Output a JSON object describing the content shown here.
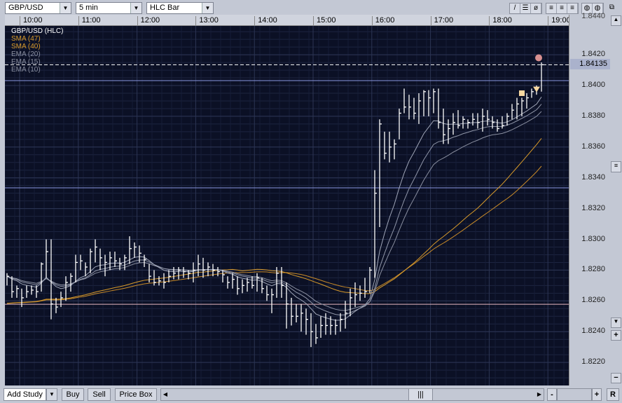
{
  "toolbar": {
    "symbol": "GBP/USD",
    "interval": "5 min",
    "chart_type": "HLC Bar",
    "tools": [
      "line-tool-icon",
      "hline-tool-icon",
      "no-draw-icon",
      "grid1-icon",
      "grid2-icon",
      "grid3-icon",
      "theme1-icon",
      "theme2-icon",
      "window-icon"
    ]
  },
  "time_axis": [
    "10:00",
    "11:00",
    "12:00",
    "13:00",
    "14:00",
    "15:00",
    "16:00",
    "17:00",
    "18:00",
    "19:00"
  ],
  "price_axis": [
    "1.8420",
    "1.8400",
    "1.8380",
    "1.8360",
    "1.8340",
    "1.8320",
    "1.8300",
    "1.8280",
    "1.8260",
    "1.8240",
    "1.8220"
  ],
  "price_axis_top_partial": "1.8440",
  "current_price": "1.84135",
  "legend": [
    {
      "label": "GBP/USD (HLC)",
      "color": "#ffffff"
    },
    {
      "label": "SMA (47)",
      "color": "#d89a2a"
    },
    {
      "label": "SMA (40)",
      "color": "#d89a2a"
    },
    {
      "label": "EMA (20)",
      "color": "#8a8fa0"
    },
    {
      "label": "EMA (15)",
      "color": "#8a8fa0"
    },
    {
      "label": "EMA (10)",
      "color": "#8a8fa0"
    }
  ],
  "bottom": {
    "add_study": "Add Study",
    "buy": "Buy",
    "sell": "Sell",
    "price_box": "Price Box",
    "zoom_out": "-",
    "zoom_in": "+",
    "reset": "R"
  },
  "chart_data": {
    "type": "hlc-bar",
    "start_time": "09:45",
    "interval_minutes": 5,
    "ylim": [
      1.8208,
      1.8442
    ],
    "horizontal_lines": [
      {
        "price": 1.84135,
        "style": "dashed",
        "color": "#ffffff"
      },
      {
        "price": 1.84032,
        "color": "#8a96e0"
      },
      {
        "price": 1.83335,
        "color": "#8a96e0"
      },
      {
        "price": 1.82578,
        "color": "#e8b8c0"
      }
    ],
    "markers": [
      {
        "type": "square",
        "bar": 105,
        "price": 1.8395,
        "color": "#f8d8a0"
      },
      {
        "type": "triangle-down",
        "bar": 108,
        "price": 1.8397,
        "color": "#f8d8a0"
      },
      {
        "type": "circle",
        "bar": 109,
        "price": 1.8418,
        "color": "#d89090"
      }
    ],
    "bars": [
      [
        1.8278,
        1.827,
        1.8276
      ],
      [
        1.8276,
        1.8262,
        1.8266
      ],
      [
        1.827,
        1.8262,
        1.8268
      ],
      [
        1.8268,
        1.8256,
        1.8262
      ],
      [
        1.827,
        1.8262,
        1.8266
      ],
      [
        1.827,
        1.8264,
        1.8267
      ],
      [
        1.827,
        1.8262,
        1.8266
      ],
      [
        1.8285,
        1.8266,
        1.8284
      ],
      [
        1.83,
        1.8275,
        1.8292
      ],
      [
        1.83,
        1.8248,
        1.8258
      ],
      [
        1.8262,
        1.8252,
        1.8256
      ],
      [
        1.8266,
        1.8256,
        1.8262
      ],
      [
        1.8276,
        1.826,
        1.8272
      ],
      [
        1.8278,
        1.8266,
        1.8276
      ],
      [
        1.829,
        1.8272,
        1.8285
      ],
      [
        1.829,
        1.828,
        1.8286
      ],
      [
        1.8285,
        1.8276,
        1.8282
      ],
      [
        1.8294,
        1.8278,
        1.8292
      ],
      [
        1.83,
        1.8285,
        1.8295
      ],
      [
        1.8294,
        1.828,
        1.8288
      ],
      [
        1.829,
        1.8276,
        1.8285
      ],
      [
        1.8292,
        1.828,
        1.8288
      ],
      [
        1.8292,
        1.8282,
        1.8286
      ],
      [
        1.8288,
        1.828,
        1.8284
      ],
      [
        1.829,
        1.828,
        1.8288
      ],
      [
        1.8302,
        1.8284,
        1.8294
      ],
      [
        1.8298,
        1.8288,
        1.8295
      ],
      [
        1.8296,
        1.8285,
        1.8291
      ],
      [
        1.829,
        1.8282,
        1.8287
      ],
      [
        1.8284,
        1.8272,
        1.8276
      ],
      [
        1.828,
        1.827,
        1.8272
      ],
      [
        1.8276,
        1.827,
        1.8273
      ],
      [
        1.8278,
        1.8268,
        1.8272
      ],
      [
        1.828,
        1.8272,
        1.8276
      ],
      [
        1.8282,
        1.8274,
        1.8278
      ],
      [
        1.8282,
        1.8274,
        1.828
      ],
      [
        1.8282,
        1.8275,
        1.8279
      ],
      [
        1.828,
        1.8274,
        1.8278
      ],
      [
        1.8285,
        1.8272,
        1.828
      ],
      [
        1.829,
        1.8276,
        1.8284
      ],
      [
        1.8288,
        1.8275,
        1.828
      ],
      [
        1.8285,
        1.8276,
        1.8282
      ],
      [
        1.8284,
        1.8276,
        1.828
      ],
      [
        1.8282,
        1.8276,
        1.8279
      ],
      [
        1.828,
        1.8272,
        1.8277
      ],
      [
        1.8276,
        1.8268,
        1.8272
      ],
      [
        1.8278,
        1.8268,
        1.8274
      ],
      [
        1.8276,
        1.8264,
        1.8268
      ],
      [
        1.8274,
        1.8265,
        1.827
      ],
      [
        1.8275,
        1.8266,
        1.8272
      ],
      [
        1.8276,
        1.8268,
        1.827
      ],
      [
        1.8278,
        1.8266,
        1.8275
      ],
      [
        1.8275,
        1.8265,
        1.8268
      ],
      [
        1.827,
        1.826,
        1.8264
      ],
      [
        1.8268,
        1.8252,
        1.8264
      ],
      [
        1.8282,
        1.8262,
        1.8278
      ],
      [
        1.8282,
        1.8262,
        1.827
      ],
      [
        1.8272,
        1.8242,
        1.8258
      ],
      [
        1.8262,
        1.8244,
        1.825
      ],
      [
        1.8258,
        1.8246,
        1.825
      ],
      [
        1.8258,
        1.824,
        1.8252
      ],
      [
        1.8255,
        1.8238,
        1.8248
      ],
      [
        1.8252,
        1.823,
        1.824
      ],
      [
        1.8245,
        1.8232,
        1.8236
      ],
      [
        1.825,
        1.8236,
        1.8244
      ],
      [
        1.8252,
        1.8238,
        1.8244
      ],
      [
        1.825,
        1.8238,
        1.8244
      ],
      [
        1.8248,
        1.8238,
        1.8244
      ],
      [
        1.8252,
        1.824,
        1.8248
      ],
      [
        1.826,
        1.8242,
        1.8252
      ],
      [
        1.8268,
        1.825,
        1.8262
      ],
      [
        1.8272,
        1.8256,
        1.8264
      ],
      [
        1.827,
        1.826,
        1.8265
      ],
      [
        1.8275,
        1.8262,
        1.8266
      ],
      [
        1.8282,
        1.8265,
        1.828
      ],
      [
        1.8345,
        1.8275,
        1.833
      ],
      [
        1.8378,
        1.8308,
        1.8375
      ],
      [
        1.837,
        1.8352,
        1.8356
      ],
      [
        1.837,
        1.835,
        1.836
      ],
      [
        1.8365,
        1.8352,
        1.8362
      ],
      [
        1.8385,
        1.8365,
        1.8382
      ],
      [
        1.8398,
        1.8382,
        1.8386
      ],
      [
        1.8394,
        1.8378,
        1.8386
      ],
      [
        1.8392,
        1.8378,
        1.8382
      ],
      [
        1.8395,
        1.8375,
        1.839
      ],
      [
        1.8397,
        1.838,
        1.8396
      ],
      [
        1.8397,
        1.838,
        1.8392
      ],
      [
        1.8398,
        1.8382,
        1.8396
      ],
      [
        1.8398,
        1.8372,
        1.8376
      ],
      [
        1.8385,
        1.8362,
        1.8368
      ],
      [
        1.8378,
        1.8362,
        1.8372
      ],
      [
        1.8382,
        1.8368,
        1.8376
      ],
      [
        1.8384,
        1.8372,
        1.8374
      ],
      [
        1.838,
        1.8372,
        1.8378
      ],
      [
        1.8378,
        1.8372,
        1.8376
      ],
      [
        1.8382,
        1.8374,
        1.8378
      ],
      [
        1.8382,
        1.8372,
        1.8376
      ],
      [
        1.8385,
        1.837,
        1.838
      ],
      [
        1.8384,
        1.8374,
        1.8378
      ],
      [
        1.838,
        1.8372,
        1.8376
      ],
      [
        1.8378,
        1.837,
        1.8372
      ],
      [
        1.838,
        1.8372,
        1.8374
      ],
      [
        1.8382,
        1.8374,
        1.838
      ],
      [
        1.8388,
        1.8378,
        1.8384
      ],
      [
        1.8392,
        1.8378,
        1.8388
      ],
      [
        1.8392,
        1.838,
        1.839
      ],
      [
        1.8395,
        1.8385,
        1.8392
      ],
      [
        1.8398,
        1.8392,
        1.8396
      ],
      [
        1.84,
        1.8394,
        1.8398
      ],
      [
        1.8415,
        1.8396,
        1.84135
      ]
    ],
    "studies": [
      {
        "name": "SMA",
        "period": 47
      },
      {
        "name": "SMA",
        "period": 40
      },
      {
        "name": "EMA",
        "period": 20
      },
      {
        "name": "EMA",
        "period": 15
      },
      {
        "name": "EMA",
        "period": 10
      }
    ]
  }
}
